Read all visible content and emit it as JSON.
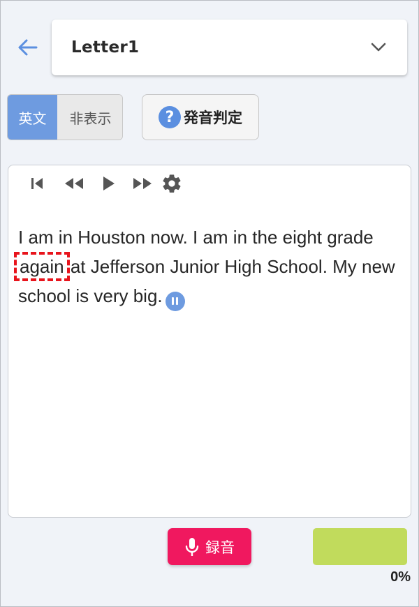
{
  "header": {
    "lesson_selected": "Letter1",
    "back_icon": "arrow-left-icon",
    "dropdown_icon": "chevron-down-icon",
    "accent_color": "#5b8fe0"
  },
  "text_toggle": {
    "on_label": "英文",
    "off_label": "非表示",
    "active": "on_label"
  },
  "pronunciation_button": {
    "icon_text": "?",
    "label": "発音判定"
  },
  "player": {
    "controls": [
      "skip-to-start-icon",
      "rewind-icon",
      "play-icon",
      "fast-forward-icon",
      "gear-icon"
    ]
  },
  "passage": {
    "before_highlight": "I am in Houston now. I am in the eight grade ",
    "highlight_word": "again",
    "after_highlight": " at Jefferson Junior High School. My new school is very big.",
    "highlight_color": "#e8141c"
  },
  "recorder": {
    "label": "録音",
    "icon": "microphone-icon",
    "color": "#f0185f"
  },
  "score": {
    "text": "0%",
    "fill_color": "#c1db5c"
  }
}
